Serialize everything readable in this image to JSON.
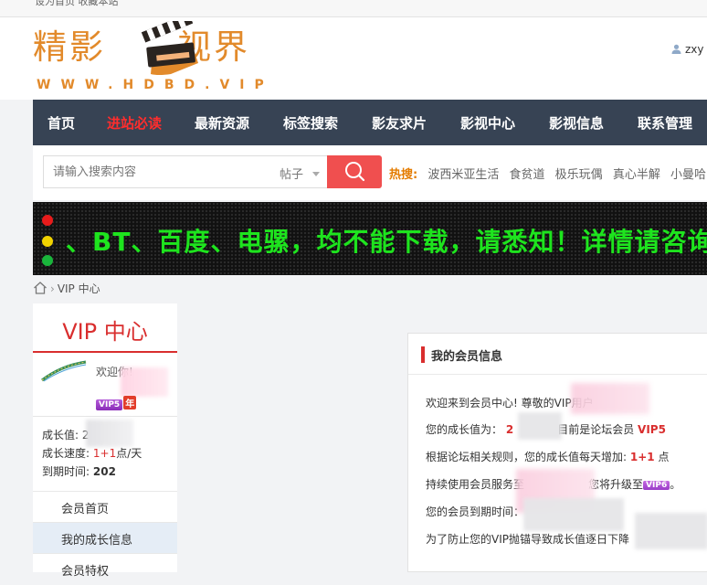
{
  "topbar": {
    "links": "设为首页 收藏本站"
  },
  "logo": {
    "part1": "精影",
    "part2": "视界",
    "url": "WWW.HDBD.VIP",
    "colors": {
      "brand": "#e28a2b"
    }
  },
  "user": {
    "name": "zxy",
    "icon": "user-icon"
  },
  "nav": {
    "items": [
      {
        "label": "首页"
      },
      {
        "label": "进站必读",
        "highlight": true
      },
      {
        "label": "最新资源"
      },
      {
        "label": "标签搜索"
      },
      {
        "label": "影友求片"
      },
      {
        "label": "影视中心"
      },
      {
        "label": "影视信息"
      },
      {
        "label": "联系管理"
      }
    ]
  },
  "search": {
    "placeholder": "请输入搜索内容",
    "type": "帖子",
    "button_icon": "search-icon",
    "hot_label": "热搜:",
    "hot_keywords": [
      "波西米亚生活",
      "食贫道",
      "极乐玩偶",
      "真心半解",
      "小曼哈"
    ]
  },
  "ticker": {
    "text": "、BT、百度、电骡，均不能下载，请悉知！详情请咨询",
    "lights": [
      "#e81b1b",
      "#f1d300",
      "#19b53b"
    ]
  },
  "breadcrumb": {
    "current": "VIP 中心",
    "home_icon": "home-icon"
  },
  "sidebar": {
    "title": "VIP 中心",
    "welcome": "欢迎你!",
    "vip_badge": "VIP5",
    "year_badge": "年",
    "growth_label": "成长值:",
    "growth_value": "2",
    "speed_label": "成长速度:",
    "speed_value": "1+1",
    "speed_unit": "点/天",
    "expire_label": "到期时间:",
    "expire_value": "202",
    "menu": [
      {
        "label": "会员首页"
      },
      {
        "label": "我的成长信息",
        "active": true
      },
      {
        "label": "会员特权"
      }
    ]
  },
  "panel": {
    "title": "我的会员信息",
    "line1": "欢迎来到会员中心! 尊敬的VIP用户",
    "line2_a": "您的成长值为：",
    "line2_value": "2",
    "line2_b": "目前是论坛会员",
    "line2_level": "VIP5",
    "line3_a": "根据论坛相关规则，您的成长值每天增加:",
    "line3_value": "1+1",
    "line3_b": "点",
    "line4_a": "持续使用会员服务至",
    "line4_b": "您将升级至",
    "line4_badge": "VIP6",
    "line4_end": "。",
    "line5": "您的会员到期时间：",
    "line6": "为了防止您的VIP抛锚导致成长值逐日下降"
  }
}
